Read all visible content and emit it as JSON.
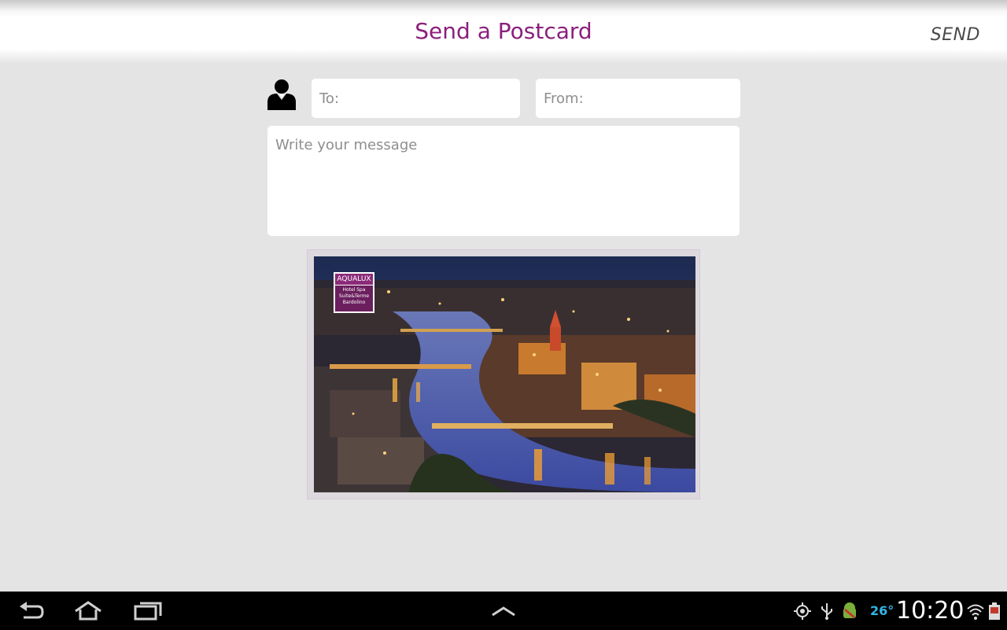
{
  "header": {
    "title": "Send a Postcard",
    "send_label": "SEND"
  },
  "form": {
    "to_placeholder": "To:",
    "from_placeholder": "From:",
    "message_placeholder": "Write your message",
    "to_value": "",
    "from_value": "",
    "message_value": ""
  },
  "postcard": {
    "logo_brand": "AQUALUX",
    "logo_line1": "Hotel Spa",
    "logo_line2": "Suite&Terme",
    "logo_line3": "Bardolino"
  },
  "navbar": {
    "icons": [
      "back-icon",
      "home-icon",
      "recent-apps-icon",
      "chevron-up-icon"
    ],
    "status_icons": [
      "location-icon",
      "usb-icon",
      "android-debug-icon",
      "weather-icon",
      "wifi-icon",
      "battery-icon"
    ],
    "temperature": "26°",
    "time": "10:20"
  },
  "colors": {
    "accent": "#8b1f7c",
    "background": "#e4e4e4",
    "navbar": "#000000",
    "status_blue": "#33b5e5"
  }
}
